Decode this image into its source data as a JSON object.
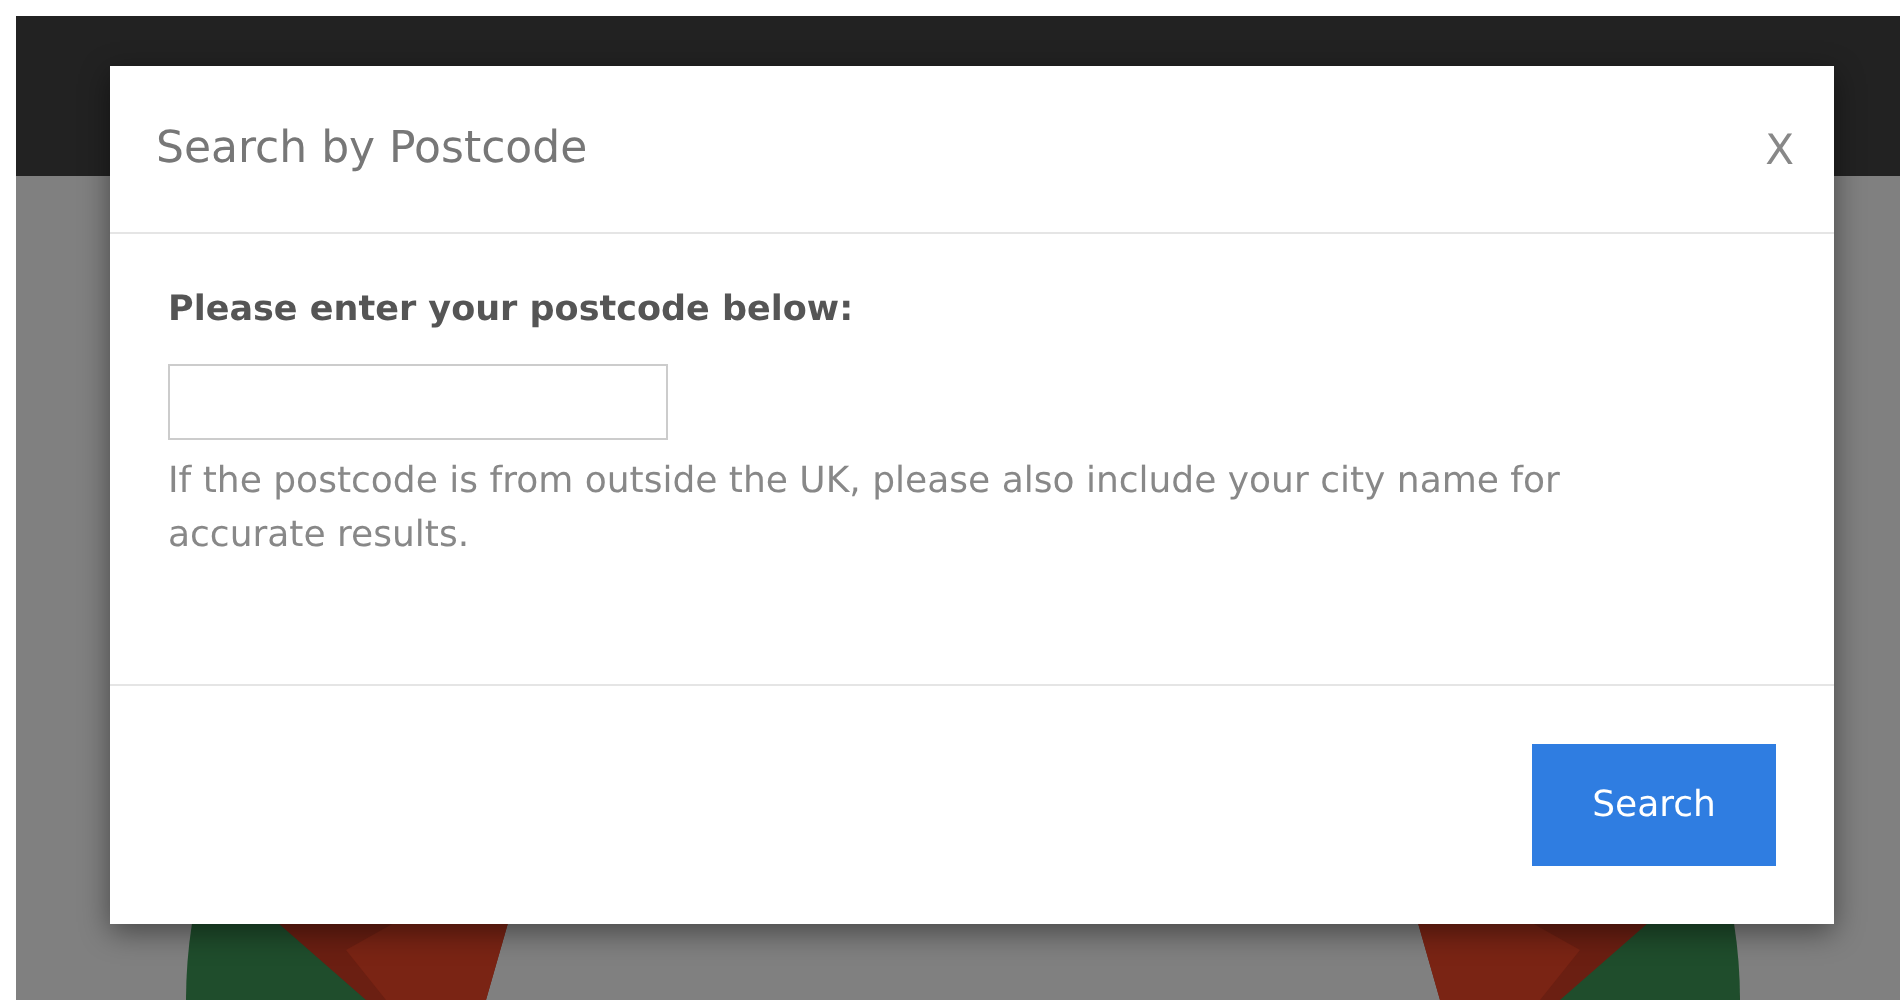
{
  "modal": {
    "title": "Search by Postcode",
    "close": "X",
    "label": "Please enter your postcode below:",
    "help": "If the postcode is from outside the UK, please also include your city name for accurate results.",
    "button": "Search"
  }
}
